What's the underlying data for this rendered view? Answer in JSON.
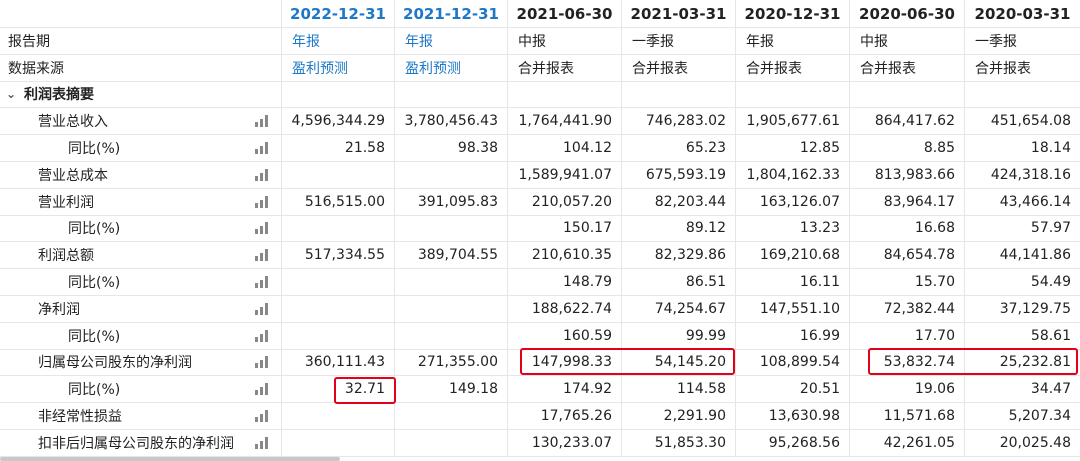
{
  "columns": [
    {
      "date": "2022-12-31",
      "period": "年报",
      "source": "盈利预测",
      "forecast": true
    },
    {
      "date": "2021-12-31",
      "period": "年报",
      "source": "盈利预测",
      "forecast": true
    },
    {
      "date": "2021-06-30",
      "period": "中报",
      "source": "合并报表",
      "forecast": false
    },
    {
      "date": "2021-03-31",
      "period": "一季报",
      "source": "合并报表",
      "forecast": false
    },
    {
      "date": "2020-12-31",
      "period": "年报",
      "source": "合并报表",
      "forecast": false
    },
    {
      "date": "2020-06-30",
      "period": "中报",
      "source": "合并报表",
      "forecast": false
    },
    {
      "date": "2020-03-31",
      "period": "一季报",
      "source": "合并报表",
      "forecast": false
    }
  ],
  "labels": {
    "report_period": "报告期",
    "data_source": "数据来源",
    "section": "利润表摘要"
  },
  "rows": [
    {
      "label": "营业总收入",
      "level": 1,
      "values": [
        "4,596,344.29",
        "3,780,456.43",
        "1,764,441.90",
        "746,283.02",
        "1,905,677.61",
        "864,417.62",
        "451,654.08"
      ]
    },
    {
      "label": "同比(%)",
      "level": 2,
      "values": [
        "21.58",
        "98.38",
        "104.12",
        "65.23",
        "12.85",
        "8.85",
        "18.14"
      ]
    },
    {
      "label": "营业总成本",
      "level": 1,
      "values": [
        "",
        "",
        "1,589,941.07",
        "675,593.19",
        "1,804,162.33",
        "813,983.66",
        "424,318.16"
      ]
    },
    {
      "label": "营业利润",
      "level": 1,
      "values": [
        "516,515.00",
        "391,095.83",
        "210,057.20",
        "82,203.44",
        "163,126.07",
        "83,964.17",
        "43,466.14"
      ]
    },
    {
      "label": "同比(%)",
      "level": 2,
      "values": [
        "",
        "",
        "150.17",
        "89.12",
        "13.23",
        "16.68",
        "57.97"
      ]
    },
    {
      "label": "利润总额",
      "level": 1,
      "values": [
        "517,334.55",
        "389,704.55",
        "210,610.35",
        "82,329.86",
        "169,210.68",
        "84,654.78",
        "44,141.86"
      ]
    },
    {
      "label": "同比(%)",
      "level": 2,
      "values": [
        "",
        "",
        "148.79",
        "86.51",
        "16.11",
        "15.70",
        "54.49"
      ]
    },
    {
      "label": "净利润",
      "level": 1,
      "values": [
        "",
        "",
        "188,622.74",
        "74,254.67",
        "147,551.10",
        "72,382.44",
        "37,129.75"
      ]
    },
    {
      "label": "同比(%)",
      "level": 2,
      "values": [
        "",
        "",
        "160.59",
        "99.99",
        "16.99",
        "17.70",
        "58.61"
      ]
    },
    {
      "label": "归属母公司股东的净利润",
      "level": 1,
      "values": [
        "360,111.43",
        "271,355.00",
        "147,998.33",
        "54,145.20",
        "108,899.54",
        "53,832.74",
        "25,232.81"
      ]
    },
    {
      "label": "同比(%)",
      "level": 2,
      "values": [
        "32.71",
        "149.18",
        "174.92",
        "114.58",
        "20.51",
        "19.06",
        "34.47"
      ]
    },
    {
      "label": "非经常性损益",
      "level": 1,
      "values": [
        "",
        "",
        "17,765.26",
        "2,291.90",
        "13,630.98",
        "11,571.68",
        "5,207.34"
      ]
    },
    {
      "label": "扣非后归属母公司股东的净利润",
      "level": 1,
      "values": [
        "",
        "",
        "130,233.07",
        "51,853.30",
        "95,268.56",
        "42,261.05",
        "20,025.48"
      ]
    }
  ],
  "colors": {
    "forecast_text": "#1e78c8",
    "highlight_box": "#e3001b"
  },
  "icons": {
    "row_chart": "bar-chart-icon",
    "section_toggle": "chevron-down-icon"
  }
}
